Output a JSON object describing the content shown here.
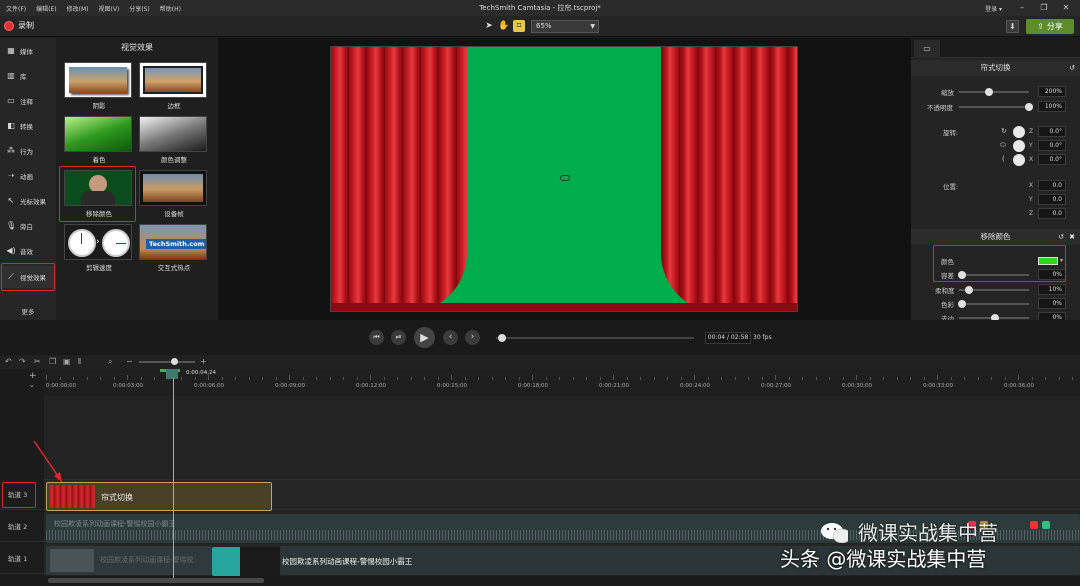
{
  "window": {
    "title": "TechSmith Camtasia - 拉帘.tscproj*",
    "menu": [
      "文件(F)",
      "编辑(E)",
      "修改(M)",
      "视图(V)",
      "分享(S)",
      "帮助(H)"
    ],
    "login": "登录 ▾"
  },
  "toolbar": {
    "record_label": "录制",
    "zoom_value": "65%",
    "share_label": "分享"
  },
  "sidebar": {
    "items": [
      {
        "label": "媒体",
        "icon": "film-icon"
      },
      {
        "label": "库",
        "icon": "library-icon"
      },
      {
        "label": "注释",
        "icon": "annotation-icon"
      },
      {
        "label": "转换",
        "icon": "transition-icon"
      },
      {
        "label": "行为",
        "icon": "behavior-icon"
      },
      {
        "label": "动画",
        "icon": "animation-icon"
      },
      {
        "label": "光标效果",
        "icon": "cursor-icon"
      },
      {
        "label": "旁白",
        "icon": "microphone-icon"
      },
      {
        "label": "音效",
        "icon": "speaker-icon"
      },
      {
        "label": "视觉效果",
        "icon": "wand-icon"
      }
    ],
    "more_label": "更多"
  },
  "effects_panel": {
    "title": "视觉效果",
    "effects": [
      {
        "label": "阴影"
      },
      {
        "label": "边框"
      },
      {
        "label": "着色"
      },
      {
        "label": "颜色调整"
      },
      {
        "label": "移除颜色"
      },
      {
        "label": "设备帧"
      },
      {
        "label": "剪辑速度"
      },
      {
        "label": "交互式热点"
      }
    ],
    "techsmith_badge": "TechSmith.com"
  },
  "properties": {
    "section1_title": "帘式切换",
    "scale_label": "缩放",
    "scale_value": "200%",
    "opacity_label": "不透明度",
    "opacity_value": "100%",
    "rotation_label": "旋转:",
    "rot_z": "0.0°",
    "rot_y": "0.0°",
    "rot_x": "0.0°",
    "position_label": "位置:",
    "pos_x": "0.0",
    "pos_y": "0.0",
    "pos_z": "0.0",
    "section2_title": "移除颜色",
    "color_label": "颜色",
    "tolerance_label": "容差",
    "tolerance_value": "0%",
    "softness_label": "柔和度",
    "softness_value": "10%",
    "hue_label": "色彩",
    "hue_value": "0%",
    "defringe_label": "去边",
    "defringe_value": "0%",
    "properties_button": "属性",
    "remove_color_swatch": "#29d629"
  },
  "playback": {
    "time": "00:04 / 02:58",
    "fps": "30 fps"
  },
  "timeline": {
    "playhead_time": "0:00:04;24",
    "ticks": [
      "0:00:00;00",
      "0:00:03;00",
      "0:00:06;00",
      "0:00:09;00",
      "0:00:12;00",
      "0:00:15;00",
      "0:00:18;00",
      "0:00:21;00",
      "0:00:24;00",
      "0:00:27;00",
      "0:00:30;00",
      "0:00:33;00",
      "0:00:36;00"
    ],
    "tracks": [
      {
        "label": "轨道 3"
      },
      {
        "label": "轨道 2"
      },
      {
        "label": "轨道 1"
      }
    ],
    "clip_track3": "帘式切换",
    "clip_track2": "校园欺凌系列动画课程-警惕校园小霸王",
    "clip_track1a": "校园欺凌系列动画课程-警惕校",
    "clip_track1b": "校园欺凌系列动画课程-警惕校园小霸王"
  },
  "watermark": {
    "line1": "微课实战集中营",
    "line2": "头条 @微课实战集中营"
  }
}
